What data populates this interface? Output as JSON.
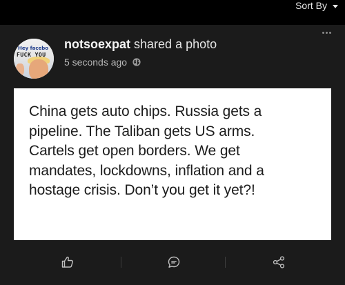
{
  "header": {
    "sort_label": "Sort By"
  },
  "post": {
    "author": "notsoexpat",
    "action_text": "shared a photo",
    "timestamp": "5 seconds ago",
    "privacy_icon": "globe-icon",
    "avatar": {
      "text_line1": "Hey facebo",
      "text_line2": "FUCK YOU"
    },
    "photo_text_lines": [
      "China gets auto chips. Russia gets a",
      "pipeline. The Taliban gets US arms.",
      "Cartels get open borders. We get",
      "mandates, lockdowns, inflation and a",
      "hostage crisis. Don’t you get it yet?!"
    ]
  },
  "actions": [
    {
      "name": "like",
      "icon": "thumbs-up-icon"
    },
    {
      "name": "comment",
      "icon": "comment-icon"
    },
    {
      "name": "share",
      "icon": "share-icon"
    }
  ],
  "colors": {
    "page_background": "#000000",
    "card_background": "#1b1b1b",
    "icon_color": "#bfbfbf"
  }
}
